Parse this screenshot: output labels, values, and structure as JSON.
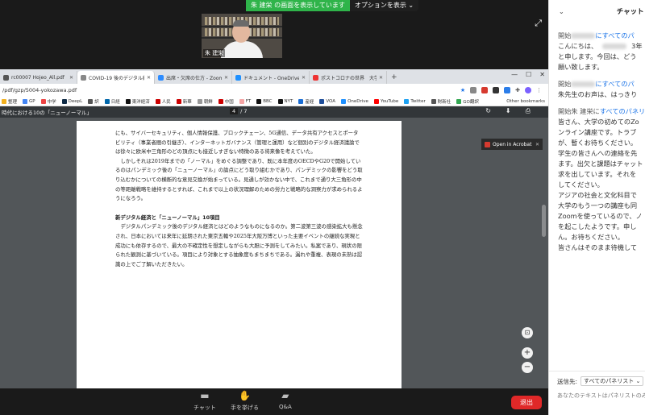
{
  "share_banner": {
    "status": "朱 建栄 の画面を表示しています",
    "options": "オプションを表示 ⌄"
  },
  "video": {
    "name": "朱 建栄"
  },
  "browser": {
    "tabs": [
      {
        "label": "rc00007 Hojeo_All.pdf",
        "color": "#555",
        "active": false
      },
      {
        "label": "COVID-19 後のデジタル経済に...",
        "color": "#888",
        "active": true
      },
      {
        "label": "出席・欠席の仕方 - Zoom",
        "color": "#2d8cff",
        "active": false
      },
      {
        "label": "ドキュメント - OneDrive",
        "color": "#1e90ff",
        "active": false
      },
      {
        "label": "ポストコロナの世界　大学ワンワン",
        "color": "#e33",
        "active": false
      }
    ],
    "new_tab": "+",
    "window_controls": [
      "—",
      "☐",
      "✕"
    ],
    "address": "/pdf/gzp/5004-yokozawa.pdf",
    "bookmarks": [
      {
        "label": "整理",
        "color": "#f2b01e"
      },
      {
        "label": "GP",
        "color": "#4285f4"
      },
      {
        "label": "中学",
        "color": "#e44"
      },
      {
        "label": "DeepL",
        "color": "#0f2b46"
      },
      {
        "label": "訳",
        "color": "#555"
      },
      {
        "label": "日経",
        "color": "#0066aa"
      },
      {
        "label": "東洋経済",
        "color": "#111"
      },
      {
        "label": "人民",
        "color": "#c00"
      },
      {
        "label": "新華",
        "color": "#c00"
      },
      {
        "label": "朝鮮",
        "color": "#999"
      },
      {
        "label": "中国",
        "color": "#c00"
      },
      {
        "label": "FT",
        "color": "#f6a5a5"
      },
      {
        "label": "BBC",
        "color": "#111"
      },
      {
        "label": "NYT",
        "color": "#111"
      },
      {
        "label": "産経",
        "color": "#1a6dd4"
      },
      {
        "label": "VOA",
        "color": "#1f4e9a"
      },
      {
        "label": "OneDrive",
        "color": "#1e90ff"
      },
      {
        "label": "YouTube",
        "color": "#f00"
      },
      {
        "label": "Twitter",
        "color": "#1da1f2"
      },
      {
        "label": "財新社",
        "color": "#555"
      },
      {
        "label": "GO翻訳",
        "color": "#34a853"
      }
    ],
    "other_bookmarks": "Other bookmarks"
  },
  "pdf": {
    "title": "時代における10の「ニューノーマル」",
    "page_current": "4",
    "page_total": "/ 7",
    "tools": [
      "↻",
      "⬇",
      "⎙"
    ],
    "open_acrobat": "Open in Acrobat",
    "paragraphs": [
      "にも、サイバーセキュリティ、個人情報保護、ブロックチェーン、5G通信、データ共有アクセスとポータビリティ（事業者間の引継ぎ）、インターネットガバナンス（管理と運用）など個別のデジタル経済議論では徐々に欧米中三角形のどの頂点にも接近しすぎない特徴のある将来像を考えていた。",
      "しかしそれは2019年までの「ノーマル」をめぐる調整であり、既に本年度のOECDやG20で開始しているのはパンデミック後の「ニューノーマル」の論点にどう取り組むかであり、パンデミックの影響をどう取り込むかについての横断的な意見交換が始まっている。見通しが効かない中で、これまで通り大三角形の中の等距離戦略を維持するとすれば、これまで以上の状況理解のための労力と戦略的な洞察力が求められるようになろう。"
    ],
    "heading": "新デジタル経済と「ニューノーマル」10項目",
    "paragraphs2": [
      "デジタルパンデミック後のデジタル経済とはどのようなものになるのか。第二波第三波の感染拡大も懸念され、日本においては来年に延期された東京五輪や2025年大阪万博といった主要イベントの継続な実現と成功にも依存するので、最大の不確定性を想定しながらも大胆に予測をしてみたい。私案であり、現状の限られた観測に基づいている。項目により対象とする抽象度もまちまちである。漏れや重複、表現の未熟は認識の上でご了解いただきたい。"
    ]
  },
  "zoom_controls": {
    "chat": "チャット",
    "raise_hand": "手を挙げる",
    "qa": "Q&A",
    "leave": "退出"
  },
  "chat": {
    "title": "チャット",
    "messages": [
      {
        "meta_prefix": "開始",
        "to": "にすべてのパ",
        "lines": [
          "こんにちは、",
          "と申します。今回は、どう",
          "願い致します。"
        ],
        "blur_first": true
      },
      {
        "meta_prefix": "開始",
        "to": "にすべてのパ",
        "lines": [
          "朱先生のお声は、はっきり"
        ],
        "blur_first": false
      },
      {
        "meta_prefix": "開始朱 建栄に",
        "to": "すべてのパネリスト",
        "lines": [
          "皆さん、大学の初めてのZo",
          "ンライン講座です。トラブ",
          "が、暫くお待ちください。",
          "学生の皆さんへの連絡を先",
          "ます。出欠と課題はチャット",
          "求を出しています。それを",
          "してください。",
          "アジアの社会と文化科目で",
          "大学のもう一つの講座も同",
          "Zoomを使っているので、ノ",
          "を起こしたようです。申し",
          "ん。お待ちください。",
          "皆さんはそのまま待機して"
        ],
        "blur_first": false
      }
    ],
    "first_line_tail": "3年",
    "send_to_label": "送信先:",
    "send_to_value": "すべてのパネリスト ⌄",
    "input_placeholder": "あなたのテキストはパネリストのみ"
  }
}
